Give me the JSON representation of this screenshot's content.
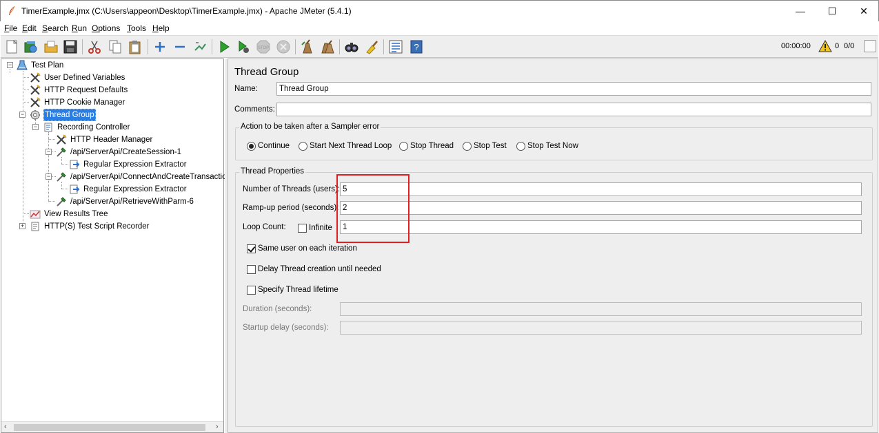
{
  "window": {
    "title": "TimerExample.jmx (C:\\Users\\appeon\\Desktop\\TimerExample.jmx) - Apache JMeter (5.4.1)",
    "minimize_glyph": "—",
    "maximize_glyph": "☐",
    "close_glyph": "✕"
  },
  "menu": [
    {
      "key": "F",
      "rest": "ile"
    },
    {
      "key": "E",
      "rest": "dit"
    },
    {
      "key": "S",
      "rest": "earch"
    },
    {
      "key": "R",
      "rest": "un"
    },
    {
      "key": "O",
      "rest": "ptions"
    },
    {
      "key": "T",
      "rest": "ools"
    },
    {
      "key": "H",
      "rest": "elp"
    }
  ],
  "toolbar": {
    "icons": [
      "new-icon",
      "templates-icon",
      "open-icon",
      "save-icon",
      "cut-icon",
      "copy-icon",
      "paste-icon",
      "expand-icon",
      "collapse-icon",
      "toggle-icon",
      "start-icon",
      "start-no-pauses-icon",
      "stop-icon",
      "shutdown-icon",
      "clear-icon",
      "clear-all-icon",
      "search-icon",
      "reset-search-icon",
      "function-helper-icon",
      "help-icon"
    ],
    "timer": "00:00:00",
    "warning_count": "0",
    "threads_ratio": "0/0"
  },
  "tree": [
    {
      "label": "Test Plan",
      "icon": "test-plan-icon"
    },
    {
      "label": "User Defined Variables",
      "icon": "config-element-icon"
    },
    {
      "label": "HTTP Request Defaults",
      "icon": "config-element-icon"
    },
    {
      "label": "HTTP Cookie Manager",
      "icon": "config-element-icon"
    },
    {
      "label": "Thread Group",
      "icon": "thread-group-icon"
    },
    {
      "label": "Recording Controller",
      "icon": "controller-icon"
    },
    {
      "label": "HTTP Header Manager",
      "icon": "config-element-icon"
    },
    {
      "label": "/api/ServerApi/CreateSession-1",
      "icon": "sampler-icon"
    },
    {
      "label": "Regular Expression Extractor",
      "icon": "post-processor-icon"
    },
    {
      "label": "/api/ServerApi/ConnectAndCreateTransaction",
      "icon": "sampler-icon"
    },
    {
      "label": "Regular Expression Extractor",
      "icon": "post-processor-icon"
    },
    {
      "label": "/api/ServerApi/RetrieveWithParm-6",
      "icon": "sampler-icon"
    },
    {
      "label": "View Results Tree",
      "icon": "listener-icon"
    },
    {
      "label": "HTTP(S) Test Script Recorder",
      "icon": "non-test-element-icon"
    }
  ],
  "panel": {
    "title": "Thread Group",
    "name_label": "Name:",
    "name_value": "Thread Group",
    "comments_label": "Comments:",
    "comments_value": "",
    "error_group_title": "Action to be taken after a Sampler error",
    "error_options": [
      {
        "label": "Continue",
        "selected": true
      },
      {
        "label": "Start Next Thread Loop",
        "selected": false
      },
      {
        "label": "Stop Thread",
        "selected": false
      },
      {
        "label": "Stop Test",
        "selected": false
      },
      {
        "label": "Stop Test Now",
        "selected": false
      }
    ],
    "thread_props_title": "Thread Properties",
    "threads_label": "Number of Threads (users):",
    "threads_value": "5",
    "rampup_label": "Ramp-up period (seconds):",
    "rampup_value": "2",
    "loop_label": "Loop Count:",
    "infinite_label": "Infinite",
    "infinite_checked": false,
    "loop_value": "1",
    "same_user_label": "Same user on each iteration",
    "same_user_checked": true,
    "delay_label": "Delay Thread creation until needed",
    "delay_checked": false,
    "lifetime_label": "Specify Thread lifetime",
    "lifetime_checked": false,
    "duration_label": "Duration (seconds):",
    "duration_value": "",
    "startup_delay_label": "Startup delay (seconds):",
    "startup_delay_value": ""
  },
  "colors": {
    "selection": "#2a7de1",
    "highlight_box": "#e02020",
    "panel_bg": "#eeeeee"
  }
}
